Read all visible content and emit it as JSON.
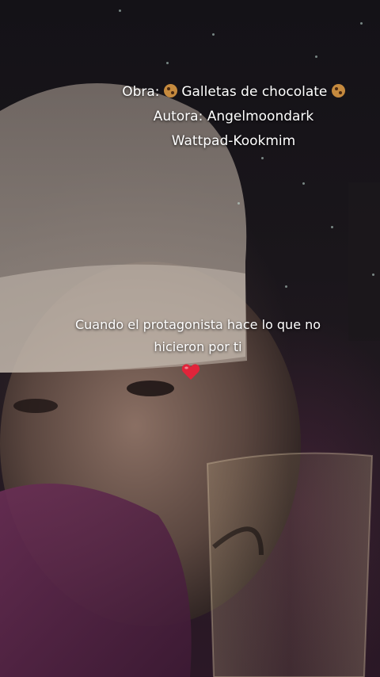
{
  "credits": {
    "line1_prefix": "Obra:",
    "line1_title": "Galletas de chocolate",
    "line2": "Autora: Angelmoondark",
    "line3": "Wattpad-Kookmim"
  },
  "caption": {
    "line1": "Cuando el protagonista hace lo que no",
    "line2": "hicieron por ti"
  },
  "icons": {
    "cookie": "cookie-emoji",
    "heart": "red-heart-emoji"
  },
  "colors": {
    "text": "#ffffff",
    "heart": "#e0243a",
    "cookie": "#c58a3e"
  }
}
